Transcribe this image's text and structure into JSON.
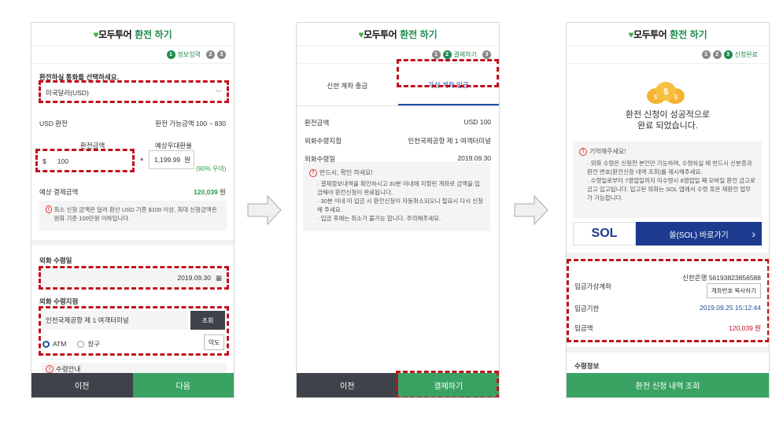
{
  "header": {
    "logo": "모두투어",
    "title": "환전 하기"
  },
  "s1": {
    "step_label": "정보입력",
    "currency_q": "환전하실 통화를 선택하세요.",
    "currency_value": "미국달러(USD)",
    "usd_label": "USD 환전",
    "usd_range": "환전 가능금액 100 ~ 830",
    "amount_label": "환전금액",
    "rate_label": "예상우대환율",
    "currency_sign": "$",
    "amount": "100",
    "times": "*",
    "rate": "1,199.99",
    "rate_unit": "원",
    "pref": "(90% 우대)",
    "total_label": "예상 결제금액",
    "total_value": "120,039",
    "total_unit": "원",
    "notice": "최소 신청 금액은 달러 환산 USD 기준 $100 이상, 최대 신청금액은 원화 기준 100만원 이하입니다.",
    "date_label": "외화 수령일",
    "date_value": "2019.09.30",
    "branch_label": "외화 수령지점",
    "branch_value": "인천국제공항 제 1 여객터미널",
    "search_btn": "조회",
    "opt_atm": "ATM",
    "opt_counter": "창구",
    "map_btn": "약도",
    "guide": "수령안내",
    "prev": "이전",
    "next": "다음"
  },
  "s2": {
    "step_label": "결제하기",
    "tab1": "신한 계좌 출금",
    "tab2": "가상 계좌 입금",
    "rows": [
      {
        "k": "환전금액",
        "v": "USD  100"
      },
      {
        "k": "외화수령지점",
        "v": "인천국제공항 제 1 여객터미널"
      },
      {
        "k": "외화수령일",
        "v": "2019.09.30"
      }
    ],
    "notice_title": "반드시, 확인 하세요!",
    "notice_items": [
      "결제정보내역을 확인하시고 30분 이내에 지정된 계좌로 금액을 입금해야 환전신청이 완료됩니다.",
      "30분 이내 미 입금 시 환전신청이 자동취소되오니 필요시 다시 신청해 주세요.",
      "입금 후에는 취소가 불가능 합니다. 주의해주세요."
    ],
    "prev": "이전",
    "pay": "결제하기"
  },
  "s3": {
    "step_label": "신청완료",
    "done_line1": "환전 신청이 성공적으로",
    "done_line2": "완료 되었습니다.",
    "remember": "기억해주세요!",
    "items": [
      "외화 수령은 신청한 본인만 가능하며, 수령하실 때 반드시 신분증과 환전 번호(환전신청 내역 조회)를 제시해주세요.",
      "수령일로부터 7영업일까지 미수령시 8영업일 째 모바일 환전 금고로 금고 입고됩니다. 입고된 외화는 SOL 앱에서 수령 혹은 재환전 업무가 가능합니다."
    ],
    "sol_logo": "SOL",
    "sol_btn": "쏠(SOL) 바로가기",
    "acct_label": "입금가상계좌",
    "acct_value": "신한은행 56193823856588",
    "copy_btn": "계좌번호 복사하기",
    "deadline_label": "입금기한",
    "deadline_value": "2019.09.25 15:12:44",
    "amt_label": "입금액",
    "amt_value": "120,039 원",
    "recv_info": "수령정보",
    "view_btn": "환전 신청 내역 조회"
  },
  "colors": {
    "brand_green": "#1e8c4e",
    "button_green": "#3aa363",
    "highlight_red": "#c0111f",
    "dark_button": "#3d4349",
    "sol_blue": "#1c3b8f"
  }
}
